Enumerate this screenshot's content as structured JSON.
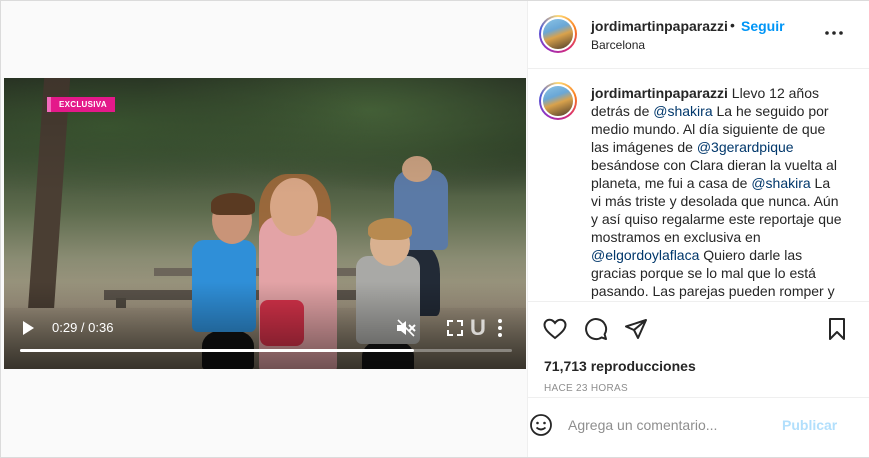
{
  "post": {
    "username": "jordimartinpaparazzi",
    "separator": "•",
    "follow_label": "Seguir",
    "location": "Barcelona",
    "more_icon": "more-horizontal-icon"
  },
  "video": {
    "badge": "EXCLUSIVA",
    "watermark": "U",
    "time": "0:29 / 0:36",
    "progress": 0.8,
    "muted": true,
    "play_icon": "play-icon",
    "mute_icon": "muted-speaker-icon",
    "fullscreen_icon": "fullscreen-icon",
    "menu_icon": "more-vertical-icon"
  },
  "caption": {
    "username": "jordimartinpaparazzi",
    "parts": [
      {
        "t": " Llevo 12 años detrás de "
      },
      {
        "m": "@shakira"
      },
      {
        "t": " La he seguido por medio mundo. Al día siguiente de que las imágenes de "
      },
      {
        "m": "@3gerardpique"
      },
      {
        "t": " besándose con Clara dieran la vuelta al planeta, me fui a casa de "
      },
      {
        "m": "@shakira"
      },
      {
        "t": " La vi más triste y desolada que nunca. Aún y así quiso regalarme este reportaje que mostramos en exclusiva en "
      },
      {
        "m": "@elgordoylaflaca"
      },
      {
        "t": " Quiero darle las gracias porque se lo mal que lo está pasando. Las parejas pueden romper y"
      }
    ]
  },
  "actions": {
    "like_icon": "heart-icon",
    "comment_icon": "comment-icon",
    "share_icon": "send-icon",
    "save_icon": "bookmark-icon"
  },
  "stats": {
    "views": "71,713 reproducciones",
    "time_ago": "HACE 23 HORAS"
  },
  "comment": {
    "emoji_icon": "emoji-icon",
    "placeholder": "Agrega un comentario...",
    "publish_label": "Publicar"
  },
  "colors": {
    "accent": "#0095f6",
    "mention": "#00376b",
    "publish_disabled": "#b2dffc",
    "badge": "#e4198a"
  }
}
